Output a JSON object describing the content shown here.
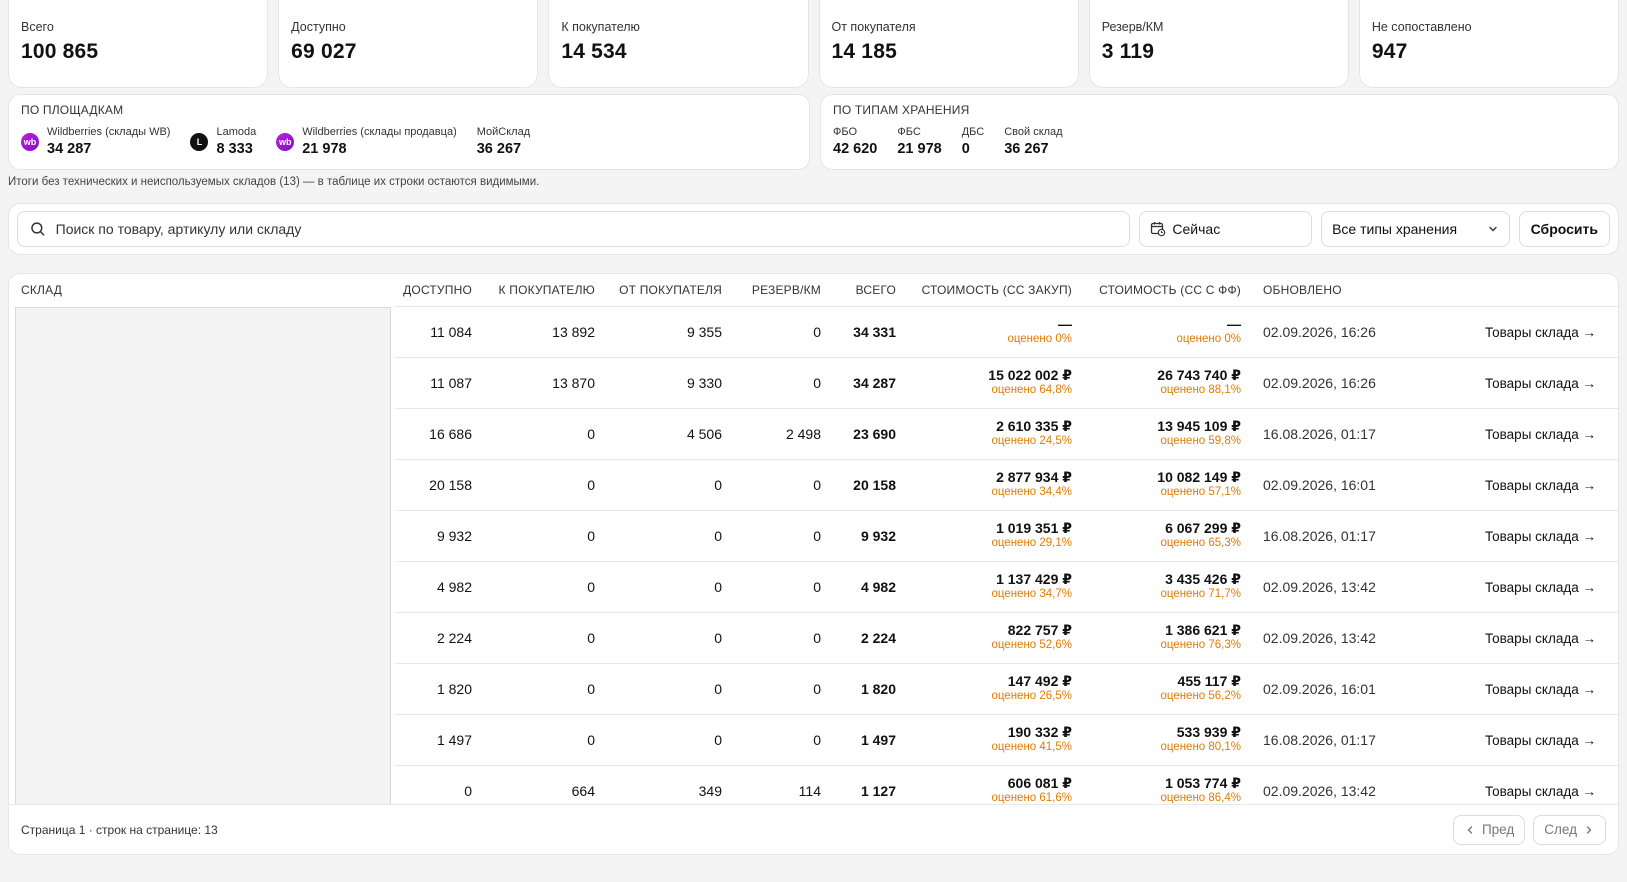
{
  "stats": [
    {
      "label": "Всего",
      "value": "100 865"
    },
    {
      "label": "Доступно",
      "value": "69 027"
    },
    {
      "label": "К покупателю",
      "value": "14 534"
    },
    {
      "label": "От покупателя",
      "value": "14 185"
    },
    {
      "label": "Резерв/КМ",
      "value": "3 119"
    },
    {
      "label": "Не сопоставлено",
      "value": "947"
    }
  ],
  "platforms": {
    "title": "ПО ПЛОЩАДКАМ",
    "items": [
      {
        "icon": "wb",
        "icon_text": "wb",
        "label": "Wildberries (склады WB)",
        "value": "34 287"
      },
      {
        "icon": "lm",
        "icon_text": "L",
        "label": "Lamoda",
        "value": "8 333"
      },
      {
        "icon": "wb",
        "icon_text": "wb",
        "label": "Wildberries (склады продавца)",
        "value": "21 978"
      },
      {
        "icon": "none",
        "icon_text": "",
        "label": "МойСклад",
        "value": "36 267"
      }
    ]
  },
  "storage": {
    "title": "ПО ТИПАМ ХРАНЕНИЯ",
    "items": [
      {
        "label": "ФБО",
        "value": "42 620"
      },
      {
        "label": "ФБС",
        "value": "21 978"
      },
      {
        "label": "ДБС",
        "value": "0"
      },
      {
        "label": "Свой склад",
        "value": "36 267"
      }
    ]
  },
  "note": "Итоги без технических и неиспользуемых складов (13) — в таблице их строки остаются видимыми.",
  "filters": {
    "search_placeholder": "Поиск по товару, артикулу или складу",
    "date_label": "Сейчас",
    "storage_select": "Все типы хранения",
    "reset_label": "Сбросить"
  },
  "table": {
    "headers": [
      "СКЛАД",
      "ДОСТУПНО",
      "К ПОКУПАТЕЛЮ",
      "ОТ ПОКУПАТЕЛЯ",
      "РЕЗЕРВ/КМ",
      "ВСЕГО",
      "СТОИМОСТЬ (СС ЗАКУП)",
      "СТОИМОСТЬ (СС С ФФ)",
      "ОБНОВЛЕНО",
      ""
    ],
    "link_label": "Товары склада",
    "rows": [
      {
        "available": "11 084",
        "to_buyer": "13 892",
        "from_buyer": "9 355",
        "reserve": "0",
        "total": "34 331",
        "cost1": "—",
        "est1": "оценено 0%",
        "cost2": "—",
        "est2": "оценено 0%",
        "updated": "02.09.2026, 16:26"
      },
      {
        "available": "11 087",
        "to_buyer": "13 870",
        "from_buyer": "9 330",
        "reserve": "0",
        "total": "34 287",
        "cost1": "15 022 002 ₽",
        "est1": "оценено 64,8%",
        "cost2": "26 743 740 ₽",
        "est2": "оценено 88,1%",
        "updated": "02.09.2026, 16:26"
      },
      {
        "available": "16 686",
        "to_buyer": "0",
        "from_buyer": "4 506",
        "reserve": "2 498",
        "total": "23 690",
        "cost1": "2 610 335 ₽",
        "est1": "оценено 24,5%",
        "cost2": "13 945 109 ₽",
        "est2": "оценено 59,8%",
        "updated": "16.08.2026, 01:17"
      },
      {
        "available": "20 158",
        "to_buyer": "0",
        "from_buyer": "0",
        "reserve": "0",
        "total": "20 158",
        "cost1": "2 877 934 ₽",
        "est1": "оценено 34,4%",
        "cost2": "10 082 149 ₽",
        "est2": "оценено 57,1%",
        "updated": "02.09.2026, 16:01"
      },
      {
        "available": "9 932",
        "to_buyer": "0",
        "from_buyer": "0",
        "reserve": "0",
        "total": "9 932",
        "cost1": "1 019 351 ₽",
        "est1": "оценено 29,1%",
        "cost2": "6 067 299 ₽",
        "est2": "оценено 65,3%",
        "updated": "16.08.2026, 01:17"
      },
      {
        "available": "4 982",
        "to_buyer": "0",
        "from_buyer": "0",
        "reserve": "0",
        "total": "4 982",
        "cost1": "1 137 429 ₽",
        "est1": "оценено 34,7%",
        "cost2": "3 435 426 ₽",
        "est2": "оценено 71,7%",
        "updated": "02.09.2026, 13:42"
      },
      {
        "available": "2 224",
        "to_buyer": "0",
        "from_buyer": "0",
        "reserve": "0",
        "total": "2 224",
        "cost1": "822 757 ₽",
        "est1": "оценено 52,6%",
        "cost2": "1 386 621 ₽",
        "est2": "оценено 76,3%",
        "updated": "02.09.2026, 13:42"
      },
      {
        "available": "1 820",
        "to_buyer": "0",
        "from_buyer": "0",
        "reserve": "0",
        "total": "1 820",
        "cost1": "147 492 ₽",
        "est1": "оценено 26,5%",
        "cost2": "455 117 ₽",
        "est2": "оценено 56,2%",
        "updated": "02.09.2026, 16:01"
      },
      {
        "available": "1 497",
        "to_buyer": "0",
        "from_buyer": "0",
        "reserve": "0",
        "total": "1 497",
        "cost1": "190 332 ₽",
        "est1": "оценено 41,5%",
        "cost2": "533 939 ₽",
        "est2": "оценено 80,1%",
        "updated": "16.08.2026, 01:17"
      },
      {
        "available": "0",
        "to_buyer": "664",
        "from_buyer": "349",
        "reserve": "114",
        "total": "1 127",
        "cost1": "606 081 ₽",
        "est1": "оценено 61,6%",
        "cost2": "1 053 774 ₽",
        "est2": "оценено 86,4%",
        "updated": "02.09.2026, 13:42"
      }
    ]
  },
  "footer": {
    "text": "Страница 1 · строк на странице: 13",
    "prev": "Пред",
    "next": "След"
  }
}
